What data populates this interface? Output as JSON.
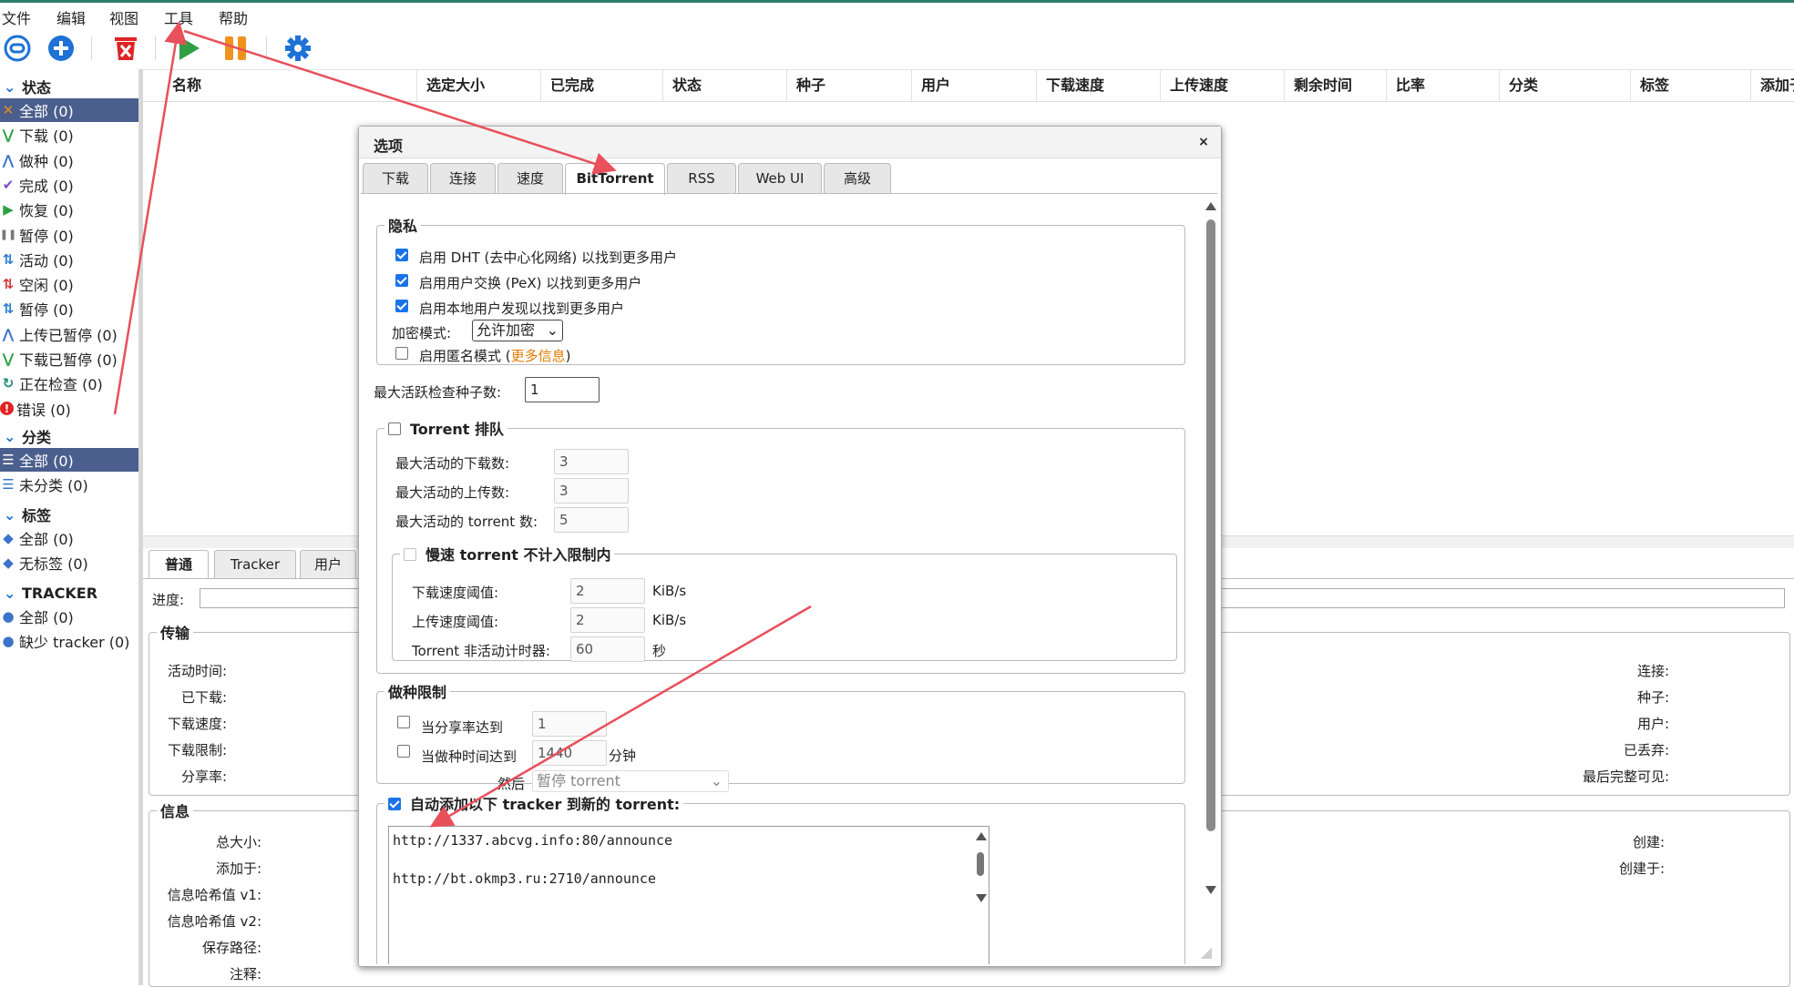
{
  "menu": [
    "文件",
    "编辑",
    "视图",
    "工具",
    "帮助"
  ],
  "sidebar": {
    "status_header": "状态",
    "status_items": [
      {
        "label": "全部 (0)",
        "icon": "shuffle-icon",
        "color": "#e08a1e",
        "selected": true
      },
      {
        "label": "下载 (0)",
        "icon": "download-icon",
        "color": "#2e9e47"
      },
      {
        "label": "做种 (0)",
        "icon": "upload-icon",
        "color": "#3b74c8"
      },
      {
        "label": "完成 (0)",
        "icon": "check-icon",
        "color": "#7a4ccf"
      },
      {
        "label": "恢复 (0)",
        "icon": "play-icon",
        "color": "#2ea043"
      },
      {
        "label": "暂停 (0)",
        "icon": "pause-icon",
        "color": "#777777"
      },
      {
        "label": "活动 (0)",
        "icon": "active-icon",
        "color": "#2c7fd1"
      },
      {
        "label": "空闲 (0)",
        "icon": "idle-icon",
        "color": "#d13b3b"
      },
      {
        "label": "暂停 (0)",
        "icon": "stalled-icon",
        "color": "#2c7fd1"
      },
      {
        "label": "上传已暂停 (0)",
        "icon": "upload-paused-icon",
        "color": "#3b74c8"
      },
      {
        "label": "下载已暂停 (0)",
        "icon": "download-paused-icon",
        "color": "#2e9e47"
      },
      {
        "label": "正在检查 (0)",
        "icon": "checking-icon",
        "color": "#1f8c7a"
      },
      {
        "label": "错误 (0)",
        "icon": "error-icon",
        "color": "#e02424"
      }
    ],
    "category_header": "分类",
    "category_items": [
      {
        "label": "全部 (0)",
        "selected": true
      },
      {
        "label": "未分类 (0)"
      }
    ],
    "tag_header": "标签",
    "tag_items": [
      {
        "label": "全部 (0)"
      },
      {
        "label": "无标签 (0)"
      }
    ],
    "tracker_header": "TRACKER",
    "tracker_items": [
      {
        "label": "全部 (0)"
      },
      {
        "label": "缺少 tracker (0)"
      }
    ]
  },
  "table": {
    "columns": [
      "名称",
      "选定大小",
      "已完成",
      "状态",
      "种子",
      "用户",
      "下载速度",
      "上传速度",
      "剩余时间",
      "比率",
      "分类",
      "标签",
      "添加于"
    ]
  },
  "detail": {
    "tabs": [
      "普通",
      "Tracker",
      "用户"
    ],
    "progress_label": "进度:",
    "transfer_legend": "传输",
    "transfer_left": [
      "活动时间:",
      "已下载:",
      "下载速度:",
      "下载限制:",
      "分享率:"
    ],
    "transfer_right": [
      "连接:",
      "种子:",
      "用户:",
      "已丢弃:",
      "最后完整可见:"
    ],
    "info_legend": "信息",
    "info_left": [
      "总大小:",
      "添加于:",
      "信息哈希值 v1:",
      "信息哈希值 v2:",
      "保存路径:",
      "注释:"
    ],
    "info_right": [
      "创建:",
      "创建于:"
    ]
  },
  "dialog": {
    "title": "选项",
    "close": "×",
    "tabs": [
      "下载",
      "连接",
      "速度",
      "BitTorrent",
      "RSS",
      "Web UI",
      "高级"
    ],
    "privacy": {
      "legend": "隐私",
      "dht": "启用 DHT (去中心化网络) 以找到更多用户",
      "pex": "启用用户交换 (PeX) 以找到更多用户",
      "lsd": "启用本地用户发现以找到更多用户",
      "encryption_label": "加密模式:",
      "encryption_value": "允许加密",
      "anon_prefix": "启用匿名模式 (",
      "anon_link": "更多信息",
      "anon_suffix": ")"
    },
    "max_checking_label": "最大活跃检查种子数:",
    "max_checking_value": "1",
    "queue": {
      "legend": "Torrent 排队",
      "max_downloads_label": "最大活动的下载数:",
      "max_downloads": "3",
      "max_uploads_label": "最大活动的上传数:",
      "max_uploads": "3",
      "max_torrents_label": "最大活动的 torrent 数:",
      "max_torrents": "5",
      "slow": {
        "legend": "慢速 torrent 不计入限制内",
        "dl_label": "下载速度阈值:",
        "dl_value": "2",
        "dl_unit": "KiB/s",
        "ul_label": "上传速度阈值:",
        "ul_value": "2",
        "ul_unit": "KiB/s",
        "timer_label": "Torrent 非活动计时器:",
        "timer_value": "60",
        "timer_unit": "秒"
      }
    },
    "seeding": {
      "legend": "做种限制",
      "ratio_label": "当分享率达到",
      "ratio_value": "1",
      "time_label": "当做种时间达到",
      "time_value": "1440",
      "time_unit": "分钟",
      "then_label": "然后",
      "then_value": "暂停 torrent"
    },
    "trackers": {
      "legend": "自动添加以下 tracker 到新的 torrent:",
      "lines": [
        "http://1337.abcvg.info:80/announce",
        "",
        "http://bt.okmp3.ru:2710/announce"
      ]
    }
  },
  "colors": {
    "annotation_arrow": "#e8505b",
    "selected_bg": "#4b5f8e",
    "accent": "#1a73e8"
  }
}
